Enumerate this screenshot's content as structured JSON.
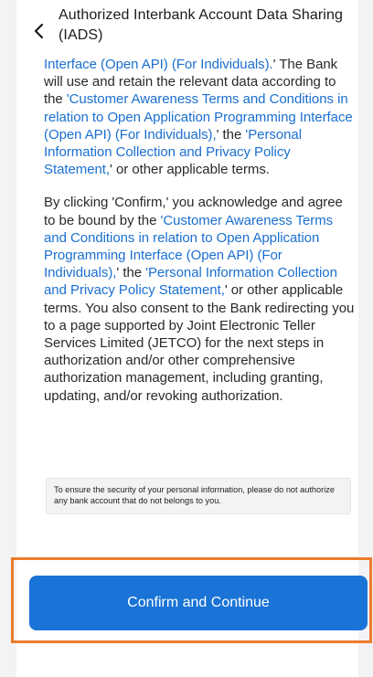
{
  "header": {
    "back_icon": "chevron-left-icon",
    "title": "Authorized Interbank Account Data Sharing (IADS)"
  },
  "content": {
    "para1": {
      "link1": "Interface (Open API) (For Individuals).",
      "text1": "' The Bank will use and retain the relevant data according to the ",
      "link2": "'Customer Awareness Terms and Conditions in relation to Open Application Programming Interface (Open API) (For Individuals),",
      "text2": "' the ",
      "link3": "'Personal Information Collection and Privacy Policy Statement,",
      "text3": "' or other applicable terms."
    },
    "para2": {
      "text1": "By clicking 'Confirm,' you acknowledge and agree to be bound by the ",
      "link1": "'Customer Awareness Terms and Conditions in relation to Open Application Programming Interface (Open API) (For Individuals),",
      "text2": "' the ",
      "link2": "'Personal Information Collection and Privacy Policy Statement,",
      "text3": "' or other applicable terms. You also consent to the Bank redirecting you to a page supported by Joint Electronic Teller Services Limited (JETCO) for the next steps in authorization and/or other comprehensive authorization management, including granting, updating, and/or revoking authorization."
    },
    "notice": "To ensure the security of your personal information, please do not authorize any bank account that do not belongs to you."
  },
  "footer": {
    "confirm_label": "Confirm and Continue"
  },
  "colors": {
    "link": "#1a6fd0",
    "button": "#1a73d6",
    "highlight": "#ee7b2c"
  }
}
